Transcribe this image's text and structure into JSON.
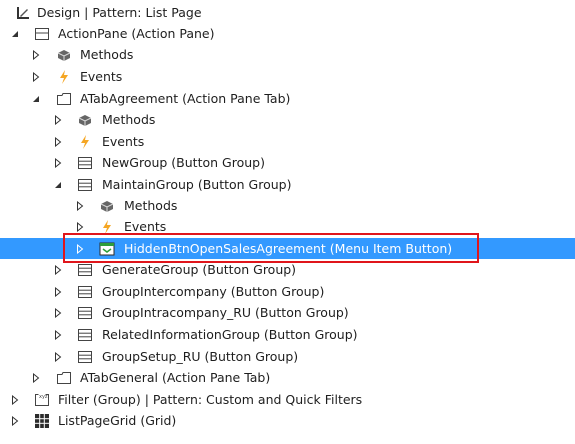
{
  "tree": {
    "nodes": [
      {
        "label": "Design | Pattern: List Page",
        "icon": "design-icon",
        "expander": "none"
      },
      {
        "label": "ActionPane (Action Pane)",
        "icon": "action-pane-icon",
        "expander": "expanded"
      },
      {
        "label": "Methods",
        "icon": "methods-icon",
        "expander": "collapsed"
      },
      {
        "label": "Events",
        "icon": "events-icon",
        "expander": "collapsed"
      },
      {
        "label": "ATabAgreement (Action Pane Tab)",
        "icon": "tab-icon",
        "expander": "expanded"
      },
      {
        "label": "Methods",
        "icon": "methods-icon",
        "expander": "collapsed"
      },
      {
        "label": "Events",
        "icon": "events-icon",
        "expander": "collapsed"
      },
      {
        "label": "NewGroup (Button Group)",
        "icon": "button-group-icon",
        "expander": "collapsed"
      },
      {
        "label": "MaintainGroup (Button Group)",
        "icon": "button-group-icon",
        "expander": "expanded"
      },
      {
        "label": "Methods",
        "icon": "methods-icon",
        "expander": "collapsed"
      },
      {
        "label": "Events",
        "icon": "events-icon",
        "expander": "collapsed"
      },
      {
        "label": "HiddenBtnOpenSalesAgreement (Menu Item Button)",
        "icon": "menu-item-button-icon",
        "expander": "collapsed",
        "selected": true
      },
      {
        "label": "GenerateGroup (Button Group)",
        "icon": "button-group-icon",
        "expander": "collapsed"
      },
      {
        "label": "GroupIntercompany (Button Group)",
        "icon": "button-group-icon",
        "expander": "collapsed"
      },
      {
        "label": "GroupIntracompany_RU (Button Group)",
        "icon": "button-group-icon",
        "expander": "collapsed"
      },
      {
        "label": "RelatedInformationGroup (Button Group)",
        "icon": "button-group-icon",
        "expander": "collapsed"
      },
      {
        "label": "GroupSetup_RU (Button Group)",
        "icon": "button-group-icon",
        "expander": "collapsed"
      },
      {
        "label": "ATabGeneral (Action Pane Tab)",
        "icon": "tab-icon",
        "expander": "collapsed"
      },
      {
        "label": "Filter (Group) | Pattern: Custom and Quick Filters",
        "icon": "filter-group-icon",
        "expander": "collapsed"
      },
      {
        "label": "ListPageGrid (Grid)",
        "icon": "grid-icon",
        "expander": "collapsed"
      }
    ]
  },
  "colors": {
    "selection": "#3399ff",
    "highlight_border": "#e0151b",
    "events_lightning": "#f5a623",
    "menu_item_green": "#2e9d3a"
  }
}
